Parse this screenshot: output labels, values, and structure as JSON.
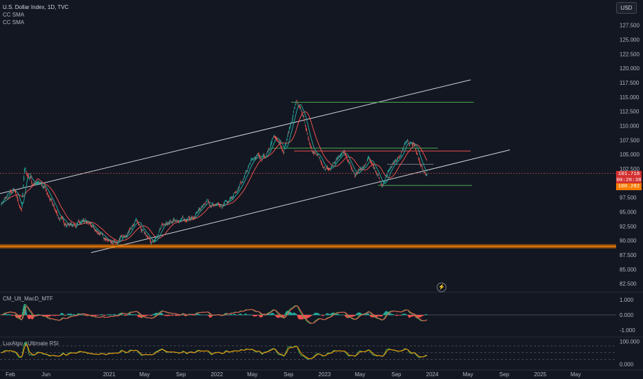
{
  "legend": {
    "title": "U.S. Dollar Index, 1D, TVC",
    "indicator1": "CC SMA",
    "indicator2": "CC SMA"
  },
  "toolbar": {
    "currency": "USD"
  },
  "chart_data": [
    {
      "type": "line",
      "title": "U.S. Dollar Index, 1D, TVC",
      "xlabel": "",
      "ylabel": "",
      "ylim": [
        81.5,
        129.5
      ],
      "y_ticks": [
        "127.500",
        "125.000",
        "122.500",
        "120.000",
        "117.500",
        "115.000",
        "112.500",
        "110.000",
        "107.500",
        "105.000",
        "102.500",
        "100.000",
        "97.500",
        "95.000",
        "92.500",
        "90.000",
        "87.500",
        "85.000",
        "82.500"
      ],
      "x_ticks": [
        "Feb",
        "Jun",
        "2021",
        "May",
        "Sep",
        "2022",
        "May",
        "Sep",
        "2023",
        "May",
        "Sep",
        "2024",
        "May",
        "Sep",
        "2025",
        "May"
      ],
      "x_tick_dates": [
        "2020-02-01",
        "2020-06-01",
        "2021-01-01",
        "2021-05-01",
        "2021-09-01",
        "2022-01-01",
        "2022-05-01",
        "2022-09-01",
        "2023-01-01",
        "2023-05-01",
        "2023-09-01",
        "2024-01-01",
        "2024-05-01",
        "2024-09-01",
        "2025-01-01",
        "2025-05-01"
      ],
      "xlim": [
        "2019-12-28",
        "2025-09-15"
      ],
      "grid": false,
      "series": [
        {
          "type": "candlestick",
          "color_up": "#26a69a",
          "color_down": "#ef5350",
          "x": [
            "2020-01-01",
            "2020-02-15",
            "2020-03-10",
            "2020-03-20",
            "2020-04-15",
            "2020-05-15",
            "2020-06-15",
            "2020-07-15",
            "2020-08-15",
            "2020-09-15",
            "2020-10-15",
            "2020-11-15",
            "2020-12-15",
            "2021-01-06",
            "2021-02-15",
            "2021-03-31",
            "2021-05-25",
            "2021-06-30",
            "2021-08-20",
            "2021-10-15",
            "2021-11-24",
            "2022-01-15",
            "2022-03-10",
            "2022-04-28",
            "2022-05-13",
            "2022-06-15",
            "2022-07-14",
            "2022-08-15",
            "2022-09-28",
            "2022-10-20",
            "2022-11-15",
            "2022-12-15",
            "2023-01-15",
            "2023-02-15",
            "2023-03-08",
            "2023-04-14",
            "2023-05-31",
            "2023-07-14",
            "2023-08-15",
            "2023-09-15",
            "2023-10-03",
            "2023-11-01",
            "2023-11-28",
            "2023-12-14"
          ],
          "y": [
            96.5,
            99.0,
            95.0,
            102.6,
            100.0,
            100.1,
            97.0,
            94.0,
            92.8,
            93.0,
            93.0,
            92.0,
            90.5,
            89.4,
            90.5,
            93.2,
            89.7,
            92.5,
            93.5,
            94.0,
            96.9,
            95.6,
            98.9,
            103.8,
            104.9,
            104.5,
            108.5,
            105.5,
            114.1,
            112.0,
            106.0,
            104.0,
            102.0,
            104.5,
            105.6,
            101.0,
            104.3,
            99.6,
            103.0,
            105.0,
            107.0,
            106.5,
            102.8,
            101.7
          ]
        },
        {
          "name": "CC SMA",
          "type": "sma",
          "color": "#ef5350"
        },
        {
          "name": "CC SMA",
          "type": "sma",
          "color": "#26a69a"
        }
      ],
      "price_labels": [
        "101.718",
        "00:20:38",
        "100.282"
      ],
      "drawings": [
        {
          "kind": "trendline",
          "from": [
            "2019-12-28",
            98.2
          ],
          "to": [
            "2024-05-10",
            118.0
          ],
          "color": "#d1d4dc"
        },
        {
          "kind": "trendline",
          "from": [
            "2020-11-01",
            87.9
          ],
          "to": [
            "2024-09-20",
            105.8
          ],
          "color": "#d1d4dc"
        },
        {
          "kind": "hline",
          "from": "2022-09-10",
          "to": "2024-05-20",
          "value": 114.1,
          "color": "#4caf50"
        },
        {
          "kind": "hline",
          "from": "2022-07-01",
          "to": "2024-01-20",
          "value": 106.1,
          "color": "#4caf50"
        },
        {
          "kind": "hline",
          "from": "2022-09-20",
          "to": "2024-05-10",
          "value": 105.6,
          "color": "#ef5350"
        },
        {
          "kind": "hline",
          "from": "2023-07-01",
          "to": "2024-05-15",
          "value": 99.6,
          "color": "#4caf50"
        },
        {
          "kind": "hline",
          "from": "2023-08-01",
          "to": "2024-01-05",
          "value": 103.3,
          "color": "#787b86"
        },
        {
          "kind": "band",
          "from": "2019-12-28",
          "to": "2025-09-15",
          "value": 89.0,
          "color": "#f57c00"
        }
      ]
    },
    {
      "type": "bar",
      "title": "CM_Ult_MacD_MTF",
      "y_ticks": [
        "1.000",
        "0.000",
        "-1.000"
      ],
      "ylim": [
        -1.35,
        1.35
      ],
      "series": [
        {
          "name": "Histogram",
          "color_pos": "#26a69a",
          "color_neg": "#ef5350"
        },
        {
          "name": "MACD",
          "color": "#4caf50"
        },
        {
          "name": "Signal",
          "color": "#ef5350"
        }
      ]
    },
    {
      "type": "line",
      "title": "LuxAlgo - Ultimate RSI",
      "y_ticks": [
        "100.000",
        "0.000"
      ],
      "ylim": [
        -20,
        110
      ],
      "levels": [
        80,
        50,
        20
      ],
      "series": [
        {
          "name": "RSI",
          "color": "#4caf50"
        },
        {
          "name": "Signal",
          "color": "#ff9800"
        }
      ]
    }
  ]
}
